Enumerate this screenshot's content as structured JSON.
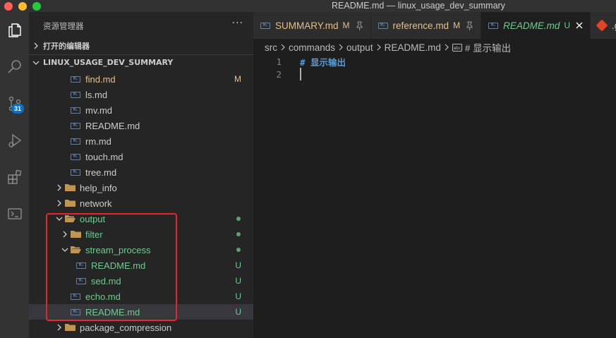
{
  "window": {
    "title": "README.md — linux_usage_dev_summary"
  },
  "activity_bar": {
    "scm_badge": "31"
  },
  "sidebar": {
    "header": "资源管理器",
    "more": "···",
    "open_editors": "打开的编辑器",
    "project": "LINUX_USAGE_DEV_SUMMARY",
    "tree": [
      {
        "label": "find.md",
        "indent": 2,
        "type": "md",
        "status": "modified",
        "deco": "M"
      },
      {
        "label": "ls.md",
        "indent": 2,
        "type": "md",
        "status": "normal",
        "deco": ""
      },
      {
        "label": "mv.md",
        "indent": 2,
        "type": "md",
        "status": "normal",
        "deco": ""
      },
      {
        "label": "README.md",
        "indent": 2,
        "type": "md",
        "status": "normal",
        "deco": ""
      },
      {
        "label": "rm.md",
        "indent": 2,
        "type": "md",
        "status": "normal",
        "deco": ""
      },
      {
        "label": "touch.md",
        "indent": 2,
        "type": "md",
        "status": "normal",
        "deco": ""
      },
      {
        "label": "tree.md",
        "indent": 2,
        "type": "md",
        "status": "normal",
        "deco": ""
      },
      {
        "label": "help_info",
        "indent": 1,
        "type": "folder",
        "open": false,
        "status": "normal",
        "deco": ""
      },
      {
        "label": "network",
        "indent": 1,
        "type": "folder",
        "open": false,
        "status": "normal",
        "deco": ""
      },
      {
        "label": "output",
        "indent": 1,
        "type": "folder",
        "open": true,
        "status": "untracked",
        "deco": "dot"
      },
      {
        "label": "filter",
        "indent": 2,
        "type": "folder",
        "open": false,
        "status": "untracked",
        "deco": "dot"
      },
      {
        "label": "stream_process",
        "indent": 2,
        "type": "folder",
        "open": true,
        "status": "untracked",
        "deco": "dot"
      },
      {
        "label": "README.md",
        "indent": 3,
        "type": "md",
        "status": "untracked",
        "deco": "U"
      },
      {
        "label": "sed.md",
        "indent": 3,
        "type": "md",
        "status": "untracked",
        "deco": "U"
      },
      {
        "label": "echo.md",
        "indent": 2,
        "type": "md",
        "status": "untracked",
        "deco": "U"
      },
      {
        "label": "README.md",
        "indent": 2,
        "type": "md",
        "status": "untracked",
        "deco": "U",
        "selected": true
      },
      {
        "label": "package_compression",
        "indent": 1,
        "type": "folder",
        "open": false,
        "status": "normal",
        "deco": ""
      }
    ]
  },
  "tabs": [
    {
      "label": "SUMMARY.md",
      "status": "M",
      "pinned": true,
      "active": false
    },
    {
      "label": "reference.md",
      "status": "M",
      "pinned": true,
      "active": false
    },
    {
      "label": "README.md",
      "status": "U",
      "pinned": false,
      "active": true
    },
    {
      "label": ".g",
      "status": "",
      "pinned": false,
      "active": false,
      "git": true
    }
  ],
  "breadcrumbs": {
    "items": [
      "src",
      "commands",
      "output",
      "README.md"
    ],
    "symbol": "# 显示输出"
  },
  "editor": {
    "lines": [
      {
        "number": "1",
        "text": "# 显示输出"
      },
      {
        "number": "2",
        "text": ""
      }
    ]
  },
  "colors": {
    "modified": "#e2c08d",
    "untracked": "#73c991",
    "highlight_box": "#e8262b",
    "badge": "#0e70c0"
  }
}
